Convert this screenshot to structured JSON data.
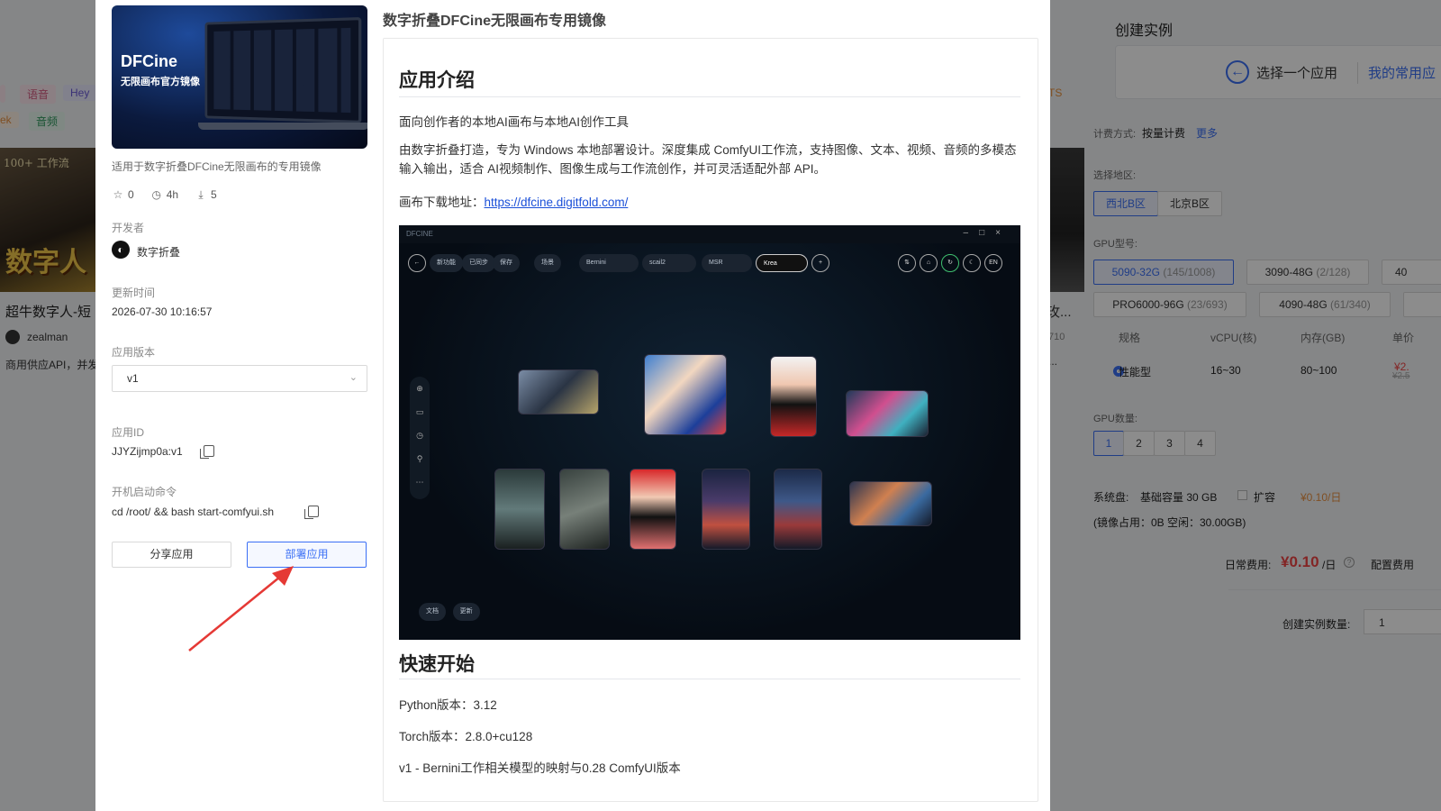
{
  "background": {
    "tags": [
      "语音",
      "Hey",
      "ek",
      "音频"
    ],
    "card": {
      "image_text_top": "100+ 工作流",
      "image_text_big": "数字人",
      "title": "超牛数字人-短",
      "author": "zealman",
      "desc": "商用供应API，并发"
    },
    "mid_card": {
      "title": "玫...",
      "count": "710",
      "dots": "..."
    },
    "ts_tag": "TS",
    "right_panel": {
      "title": "创建实例",
      "pick_app": "选择一个应用",
      "my_apps": "我的常用应",
      "billing_label": "计费方式:",
      "billing_value": "按量计费",
      "more": "更多",
      "region_label": "选择地区:",
      "regions": [
        "西北B区",
        "北京B区"
      ],
      "gpu_model_label": "GPU型号:",
      "gpus": [
        {
          "name": "5090-32G",
          "stock": "(145/1008)"
        },
        {
          "name": "3090-48G",
          "stock": "(2/128)"
        },
        {
          "name": "40",
          "stock": ""
        },
        {
          "name": "PRO6000-96G",
          "stock": "(23/693)"
        },
        {
          "name": "4090-48G",
          "stock": "(61/340)"
        }
      ],
      "table_headers": [
        "规格",
        "vCPU(核)",
        "内存(GB)",
        "单价"
      ],
      "spec_row": {
        "name": "性能型",
        "vcpu": "16~30",
        "mem": "80~100",
        "price": "¥2.",
        "price_old": "¥2.5"
      },
      "gpu_count_label": "GPU数量:",
      "gpu_counts": [
        "1",
        "2",
        "3",
        "4"
      ],
      "disk_label": "系统盘:",
      "disk_value": "基础容量 30 GB",
      "expand": "扩容",
      "expand_price": "¥0.10/日",
      "mirror_usage": "(镜像占用：0B  空闲：30.00GB)",
      "daily_fee_label": "日常费用:",
      "daily_fee_value": "¥0.10",
      "daily_fee_unit": "/日",
      "config_fee": "配置费用",
      "instance_count_label": "创建实例数量:",
      "instance_count": "1"
    }
  },
  "modal": {
    "cover": {
      "brand": "DFCine",
      "subtitle": "无限画布官方镜像"
    },
    "app_desc": "适用于数字折叠DFCine无限画布的专用镜像",
    "stats": {
      "stars": "0",
      "time": "4h",
      "downloads": "5"
    },
    "developer_label": "开发者",
    "developer_name": "数字折叠",
    "update_label": "更新时间",
    "update_value": "2026-07-30 10:16:57",
    "version_label": "应用版本",
    "version_value": "v1",
    "appid_label": "应用ID",
    "appid_value": "JJYZijmp0a:v1",
    "cmd_label": "开机启动命令",
    "cmd_value": "cd /root/ && bash start-comfyui.sh",
    "share_btn": "分享应用",
    "deploy_btn": "部署应用",
    "doc_title": "数字折叠DFCine无限画布专用镜像",
    "doc": {
      "h_intro": "应用介绍",
      "p1": "面向创作者的本地AI画布与本地AI创作工具",
      "p2": "由数字折叠打造，专为 Windows 本地部署设计。深度集成 ComfyUI工作流，支持图像、文本、视频、音频的多模态输入输出，适合 AI视频制作、图像生成与工作流创作，并可灵活适配外部 API。",
      "download_label": "画布下载地址：",
      "download_link": "https://dfcine.digitfold.com/",
      "h_quick": "快速开始",
      "python": "Python版本：3.12",
      "torch": "Torch版本：2.8.0+cu128",
      "v1_note": "v1 - Bernini工作相关模型的映射与0.28 ComfyUI版本"
    },
    "screenshot": {
      "app_name": "DFCINE",
      "tabs": [
        "新功能",
        "已同步",
        "保存",
        "场景",
        "Bernini",
        "scail2",
        "MSR",
        "Krea"
      ],
      "right_icons": [
        "EN"
      ],
      "bottom": [
        "文档",
        "更新"
      ]
    }
  }
}
